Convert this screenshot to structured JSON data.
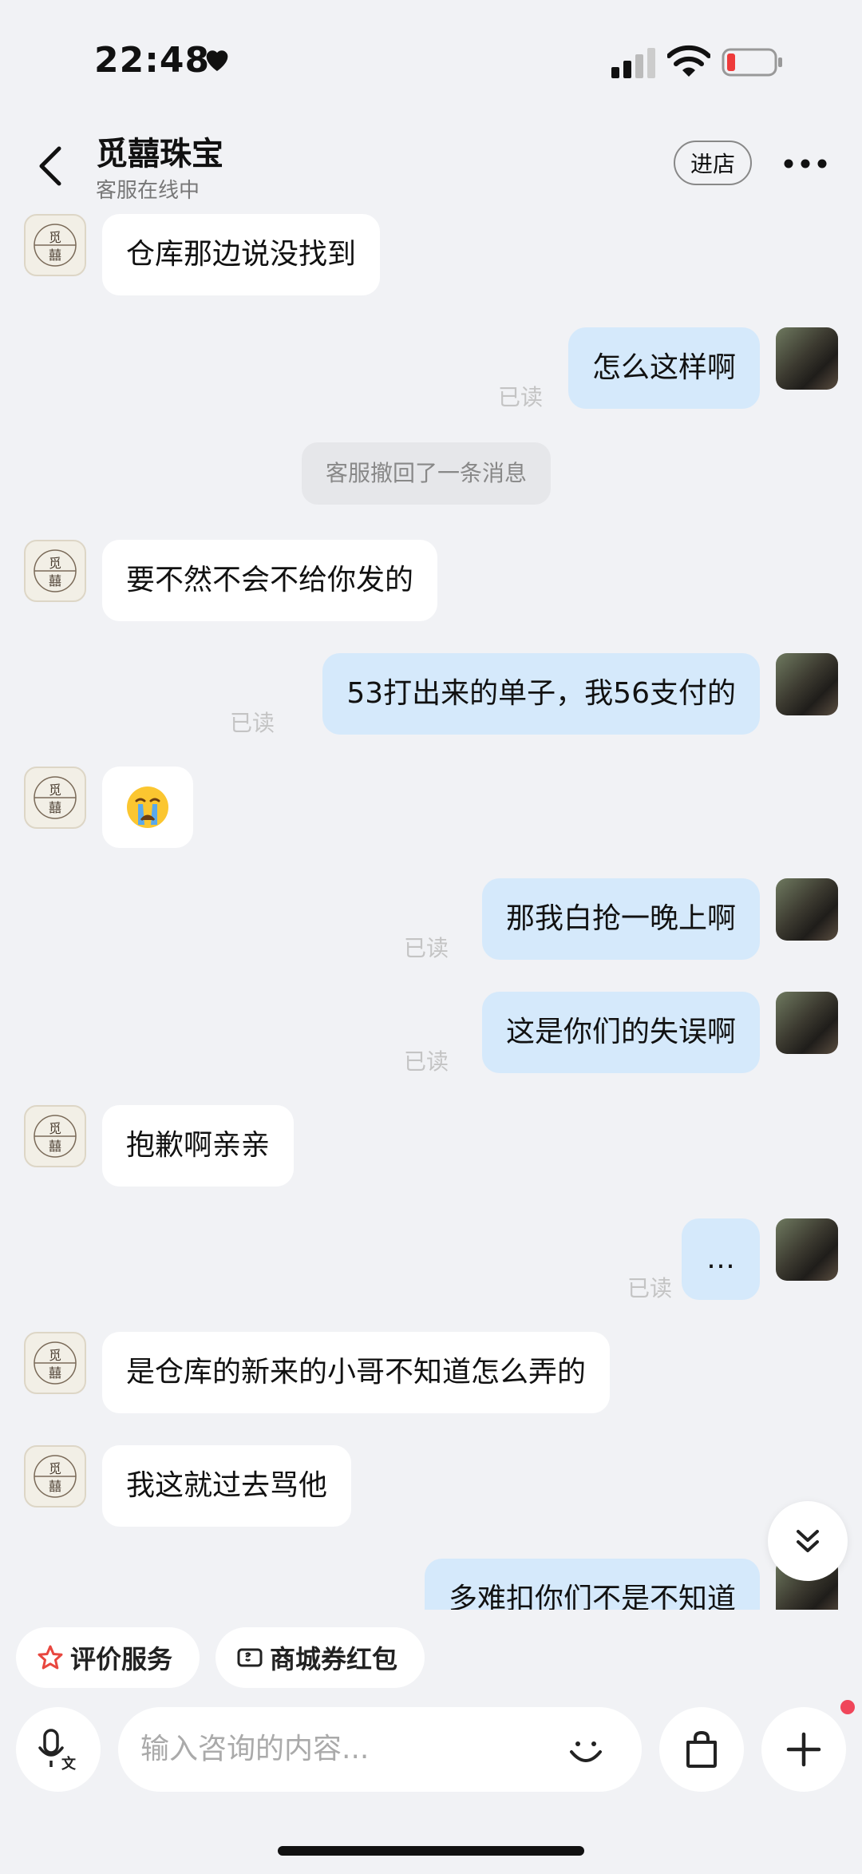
{
  "status_bar": {
    "time": "22:48"
  },
  "header": {
    "shop_name": "觅囍珠宝",
    "status": "客服在线中",
    "enter_label": "进店"
  },
  "messages": {
    "m1": {
      "text": "仓库那边说没找到"
    },
    "m2": {
      "text": "怎么这样啊",
      "read": "已读"
    },
    "m3": {
      "text": "客服撤回了一条消息"
    },
    "m4": {
      "text": "要不然不会不给你发的"
    },
    "m5": {
      "text": "53打出来的单子，我56支付的",
      "read": "已读"
    },
    "m6": {
      "text": "😭"
    },
    "m7": {
      "text": "那我白抢一晚上啊",
      "read": "已读"
    },
    "m8": {
      "text": "这是你们的失误啊",
      "read": "已读"
    },
    "m9": {
      "text": "抱歉啊亲亲"
    },
    "m10": {
      "text": "…",
      "read": "已读"
    },
    "m11": {
      "text": "是仓库的新来的小哥不知道怎么弄的"
    },
    "m12": {
      "text": "我这就过去骂他"
    },
    "m13": {
      "text": "多难扣你们不是不知道"
    }
  },
  "shop_avatar_text": "觅囍",
  "quick_actions": {
    "rate": "评价服务",
    "coupon": "商城券红包"
  },
  "input": {
    "placeholder": "输入咨询的内容..."
  },
  "colors": {
    "accent_blue": "#d5e9fb",
    "badge_red": "#f0465a",
    "rate_icon": "#e8473f"
  }
}
